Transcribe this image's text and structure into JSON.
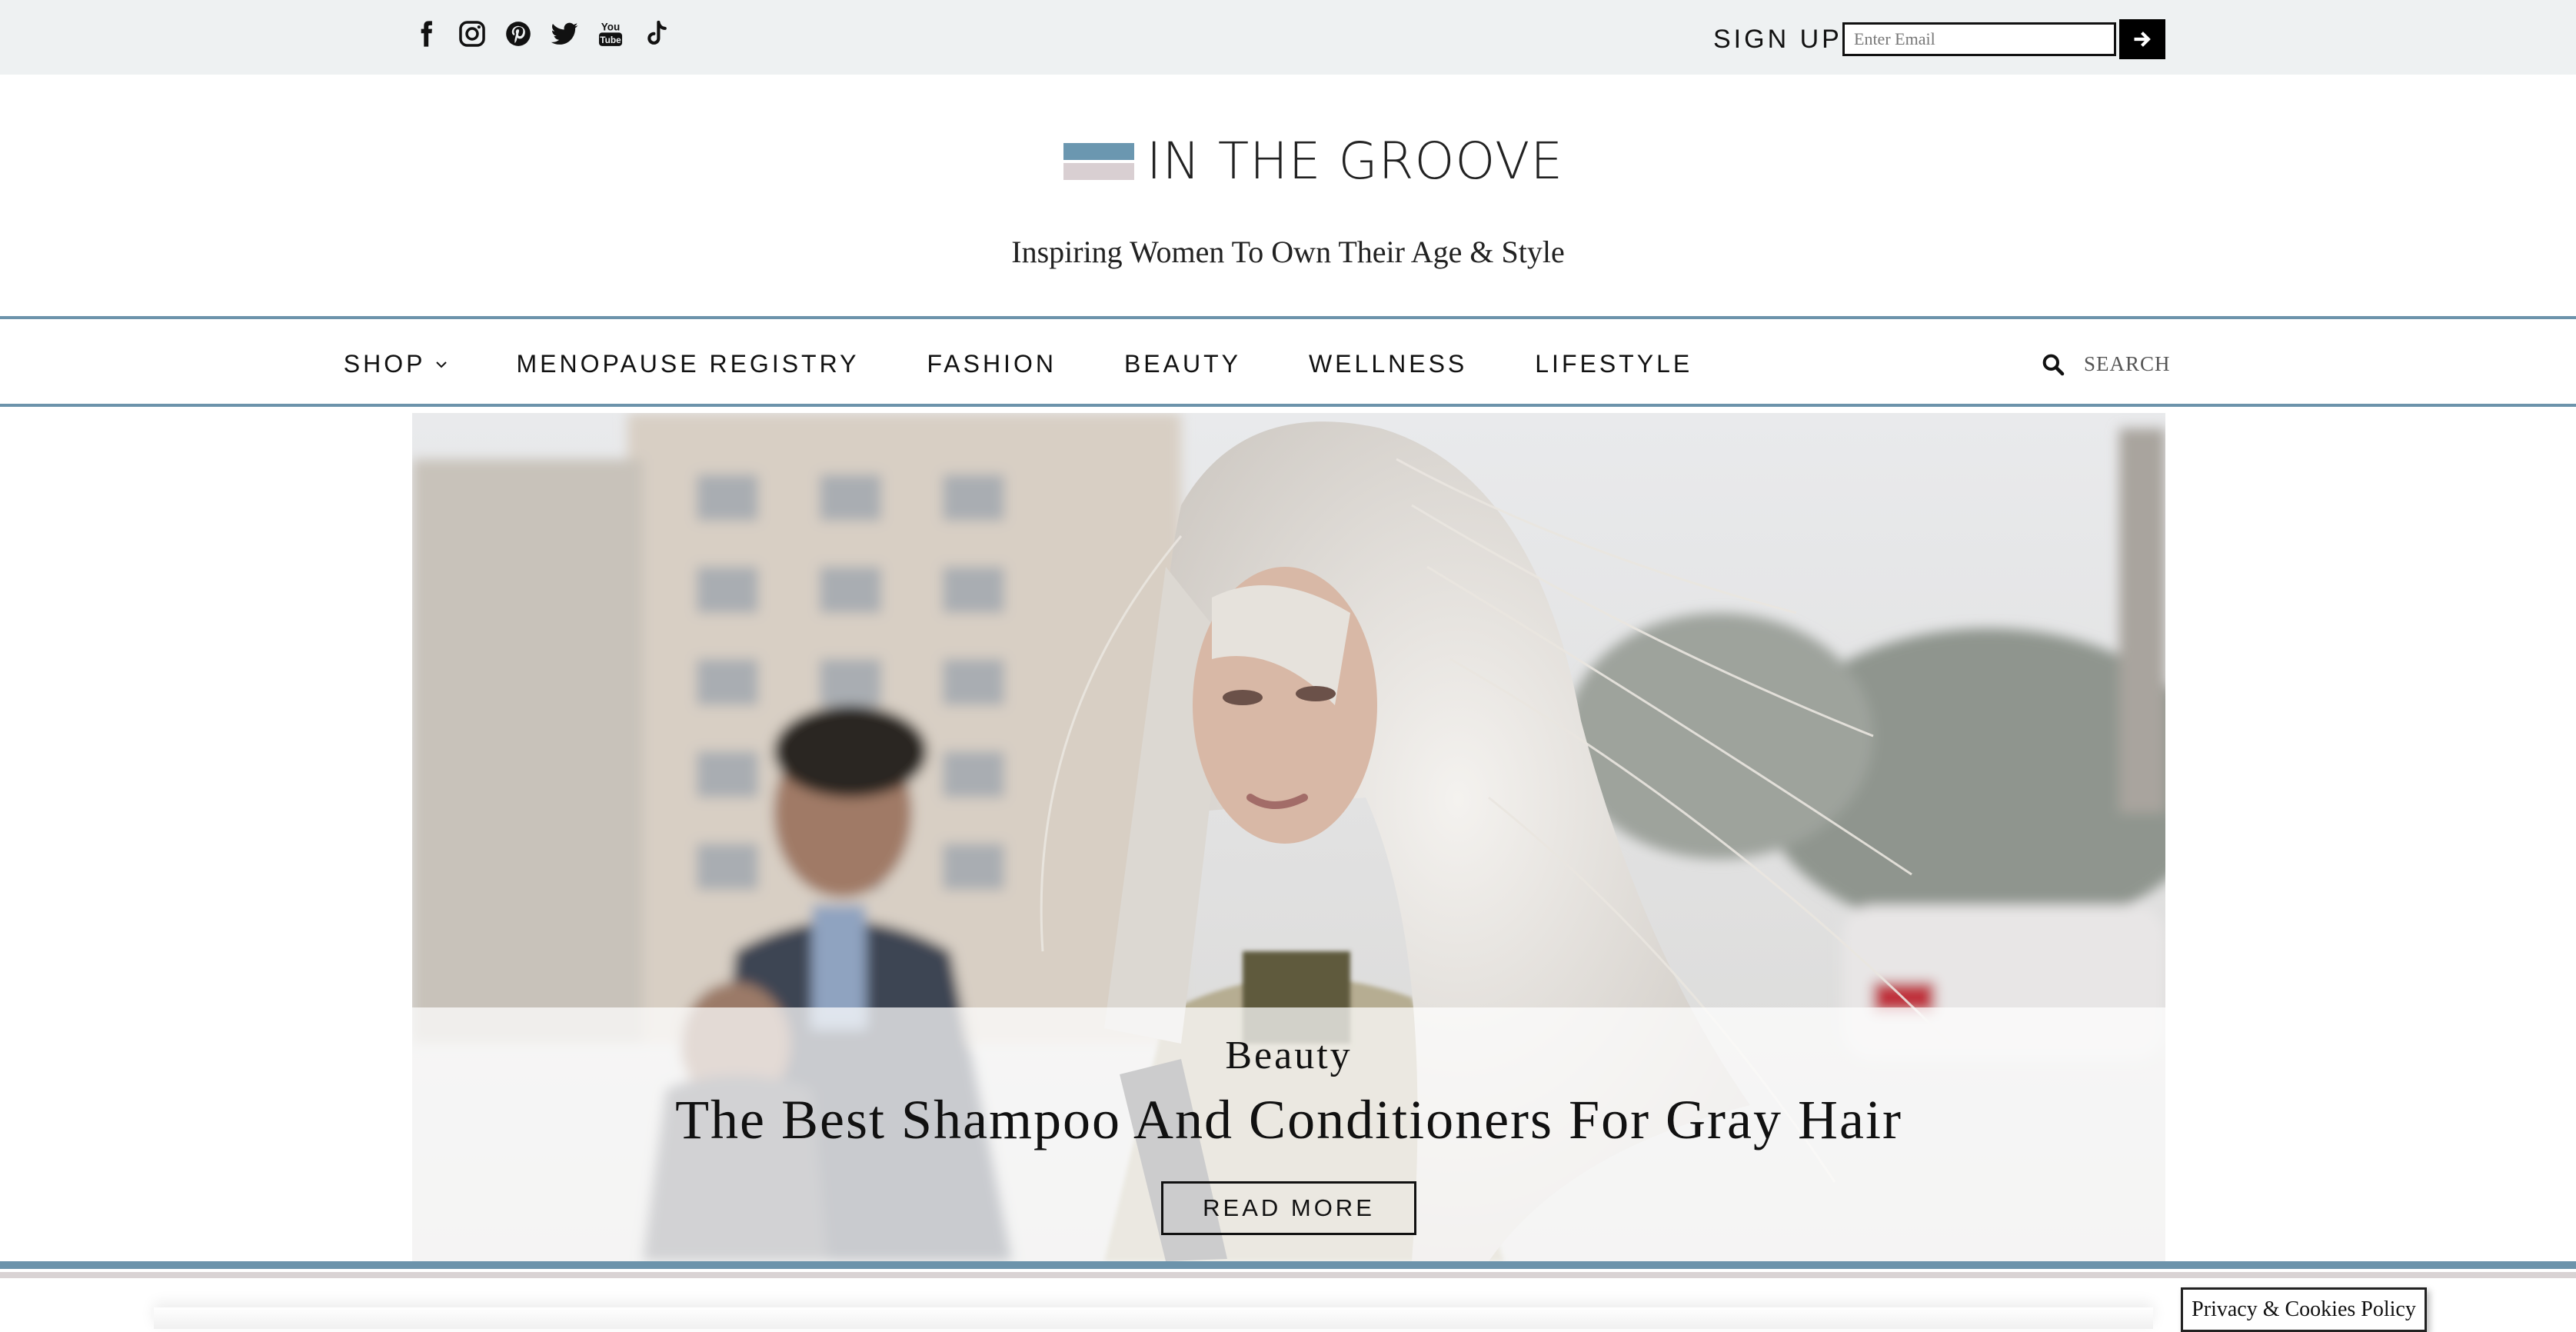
{
  "topbar": {
    "social_icons": [
      "facebook-icon",
      "instagram-icon",
      "pinterest-icon",
      "twitter-icon",
      "youtube-icon",
      "tiktok-icon"
    ],
    "signup_label": "SIGN UP",
    "email_placeholder": "Enter Email",
    "submit_icon": "arrow-right-icon"
  },
  "header": {
    "logo_text": "IN THE GROOVE",
    "tagline": "Inspiring Women To Own Their Age & Style"
  },
  "nav": {
    "items": [
      {
        "label": "SHOP",
        "has_dropdown": true
      },
      {
        "label": "MENOPAUSE REGISTRY"
      },
      {
        "label": "FASHION"
      },
      {
        "label": "BEAUTY"
      },
      {
        "label": "WELLNESS"
      },
      {
        "label": "LIFESTYLE"
      }
    ],
    "search_placeholder": "SEARCH"
  },
  "hero": {
    "category": "Beauty",
    "title": "The Best Shampoo And Conditioners For Gray Hair",
    "button_label": "READ MORE"
  },
  "footer": {
    "cookie_label": "Privacy & Cookies Policy"
  },
  "colors": {
    "accent_blue": "#6c93ab",
    "accent_pink": "#d9cfd2",
    "topbar_bg": "#eef1f2"
  }
}
